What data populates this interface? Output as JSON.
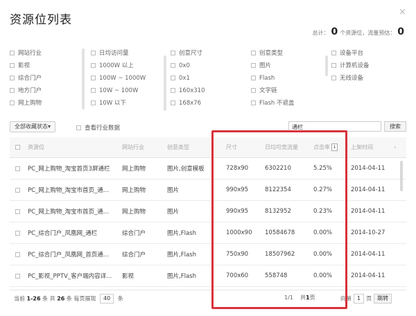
{
  "dialog": {
    "title": "资源位列表",
    "close": "×",
    "summary": {
      "prefix": "总计：",
      "resource_count": "0",
      "resource_label": "个资源位，流量预估：",
      "traffic": "0"
    }
  },
  "filters": {
    "columns": [
      [
        "网站行业",
        "影视",
        "综合门户",
        "地方门户",
        "网上购物"
      ],
      [
        "日均访问量",
        "1000W 以上",
        "100W ~ 1000W",
        "10W ~ 100W",
        "10W 以下"
      ],
      [
        "创意尺寸",
        "0x0",
        "0x1",
        "160x310",
        "168x76"
      ],
      [
        "创意类型",
        "图片",
        "Flash",
        "文字链",
        "Flash 不遮盖"
      ],
      [
        "设备平台",
        "计算机设备",
        "无线设备"
      ]
    ]
  },
  "toolbar": {
    "status_button": "全部收藏状态▾",
    "industry_checkbox": "查看行业数据",
    "search_value": "通栏",
    "search_button": "搜索"
  },
  "table": {
    "headers": [
      "资源位",
      "网站行业",
      "创意类型",
      "尺寸",
      "日均可竞流量",
      "点击率",
      "上架时间",
      "›"
    ],
    "sort_indicator": "↓",
    "rows": [
      [
        "PC_网上购物_淘宝首页3屏通栏",
        "网上购物",
        "图片,创意模板",
        "728x90",
        "6302210",
        "5.25%",
        "2014-04-11"
      ],
      [
        "PC_网上购物_淘宝市首页_通...",
        "网上购物",
        "图片",
        "990x95",
        "8122354",
        "0.27%",
        "2014-04-11"
      ],
      [
        "PC_网上购物_淘宝市首页_通...",
        "网上购物",
        "图片",
        "990x95",
        "8132952",
        "0.23%",
        "2014-04-11"
      ],
      [
        "PC_综合门户_凤凰网_通栏",
        "综合门户",
        "图片,Flash",
        "1000x90",
        "10584678",
        "0.00%",
        "2014-10-27"
      ],
      [
        "PC_综合门户_凤凰网_首页通...",
        "综合门户",
        "图片,Flash",
        "750x90",
        "18507962",
        "0.00%",
        "2014-04-11"
      ],
      [
        "PC_影视_PPTV_客户端内容详...",
        "影视",
        "图片,Flash",
        "700x60",
        "558748",
        "0.00%",
        "2014-04-11"
      ]
    ]
  },
  "footer": {
    "range_prefix": "当前",
    "range": "1-26",
    "range_suffix": "条  共",
    "total": "26",
    "total_suffix": "条  每页展现",
    "per_page": "40",
    "per_page_suffix": "条",
    "page_info": "1/1",
    "total_pages_prefix": "共",
    "total_pages": "1",
    "total_pages_suffix": "页",
    "goto_prefix": "向第",
    "goto_page": "1",
    "goto_suffix": "页",
    "goto_button": "跳转"
  },
  "colors": {
    "highlight": "#d9323a"
  }
}
